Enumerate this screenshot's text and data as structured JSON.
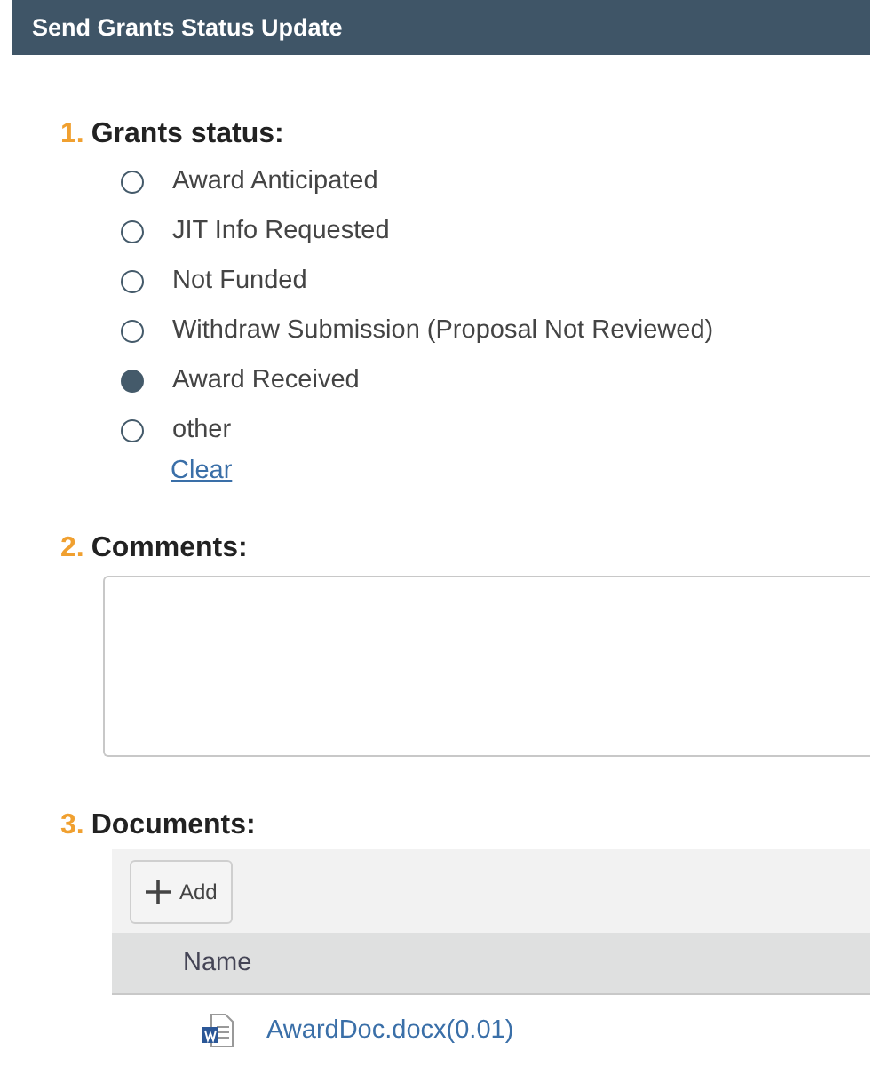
{
  "window": {
    "title": "Send Grants Status Update"
  },
  "sections": [
    {
      "kind": "radio",
      "number": "1.",
      "title": "Grants status:",
      "options": [
        {
          "label": "Award Anticipated",
          "selected": false
        },
        {
          "label": "JIT Info Requested",
          "selected": false
        },
        {
          "label": "Not Funded",
          "selected": false
        },
        {
          "label": "Withdraw Submission (Proposal Not Reviewed)",
          "selected": false
        },
        {
          "label": "Award Received",
          "selected": true
        },
        {
          "label": "other",
          "selected": false
        }
      ],
      "link": "Clear"
    },
    {
      "kind": "textarea",
      "number": "2.",
      "title": "Comments:"
    },
    {
      "kind": "documents",
      "number": "3.",
      "title": "Documents:",
      "add_button": "Add",
      "columns": [
        "Name"
      ],
      "files": [
        {
          "name": "AwardDoc.docx(0.01)"
        }
      ]
    }
  ]
}
